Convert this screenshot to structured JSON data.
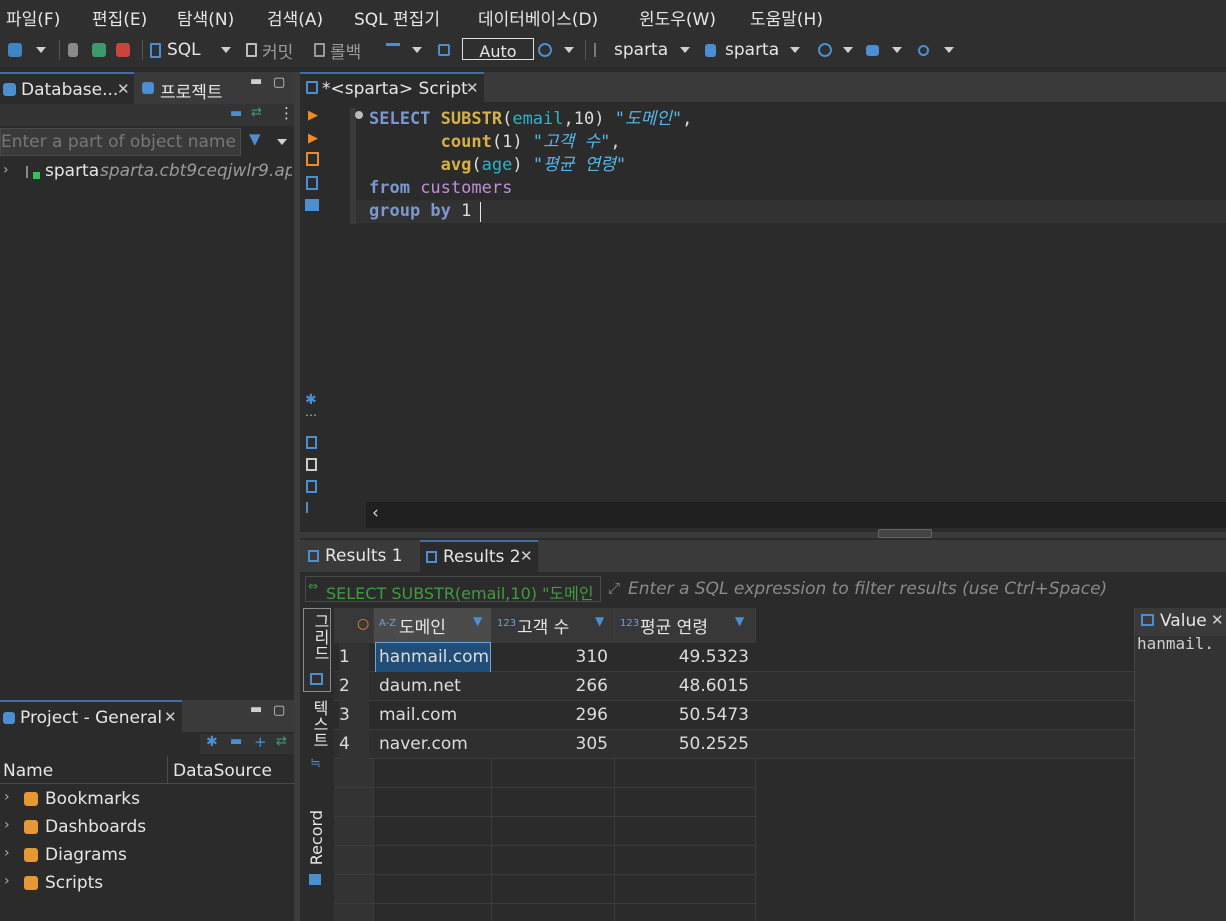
{
  "menu": [
    "파일(F)",
    "편집(E)",
    "탐색(N)",
    "검색(A)",
    "SQL 편집기",
    "데이터베이스(D)",
    "윈도우(W)",
    "도움말(H)"
  ],
  "toolbar": {
    "sql_label": "SQL",
    "commit_label": "커밋",
    "rollback_label": "롤백",
    "transaction_mode": "Auto",
    "datasource": "sparta",
    "schema": "sparta"
  },
  "db_navigator": {
    "tab_label": "Database...",
    "projects_tab_label": "프로젝트",
    "filter_placeholder": "Enter a part of object name h",
    "tree": [
      {
        "name": "sparta",
        "host": "sparta.cbt9ceqjwlr9.ap..."
      }
    ]
  },
  "project_panel": {
    "tab_label": "Project - General",
    "columns": [
      "Name",
      "DataSource"
    ],
    "items": [
      "Bookmarks",
      "Dashboards",
      "Diagrams",
      "Scripts"
    ]
  },
  "editor": {
    "tab_label": "*<sparta> Script",
    "lines": [
      {
        "parts": [
          {
            "t": "SELECT ",
            "c": "kw"
          },
          {
            "t": "SUBSTR",
            "c": "fn"
          },
          {
            "t": "(",
            "c": "plain"
          },
          {
            "t": "email",
            "c": "col"
          },
          {
            "t": ",10) ",
            "c": "plain"
          },
          {
            "t": "\"도메인\"",
            "c": "str"
          },
          {
            "t": ",",
            "c": "plain"
          }
        ]
      },
      {
        "parts": [
          {
            "t": "       ",
            "c": "plain"
          },
          {
            "t": "count",
            "c": "fn"
          },
          {
            "t": "(1) ",
            "c": "plain"
          },
          {
            "t": "\"고객 수\"",
            "c": "str"
          },
          {
            "t": ",",
            "c": "plain"
          }
        ]
      },
      {
        "parts": [
          {
            "t": "       ",
            "c": "plain"
          },
          {
            "t": "avg",
            "c": "fn"
          },
          {
            "t": "(",
            "c": "plain"
          },
          {
            "t": "age",
            "c": "col"
          },
          {
            "t": ") ",
            "c": "plain"
          },
          {
            "t": "\"평균 연령\"",
            "c": "str"
          }
        ]
      },
      {
        "parts": [
          {
            "t": "from ",
            "c": "kw"
          },
          {
            "t": "customers",
            "c": "tbl"
          }
        ]
      },
      {
        "parts": [
          {
            "t": "group by ",
            "c": "kw"
          },
          {
            "t": "1",
            "c": "num"
          }
        ]
      }
    ]
  },
  "results": {
    "tabs": [
      "Results 1",
      "Results 2"
    ],
    "active_tab": "Results 2",
    "query_preview": "SELECT SUBSTR(email,10) \"도메인",
    "filter_placeholder": "Enter a SQL expression to filter results (use Ctrl+Space)",
    "side_tabs": [
      "그리드",
      "텍스트",
      "Record"
    ],
    "columns": [
      {
        "type": "A-Z",
        "name": "도메인"
      },
      {
        "type": "123",
        "name": "고객 수"
      },
      {
        "type": "123",
        "name": "평균 연령"
      }
    ],
    "rows": [
      {
        "n": "1",
        "domain": "hanmail.com",
        "count": "310",
        "avg": "49.5323"
      },
      {
        "n": "2",
        "domain": "daum.net",
        "count": "266",
        "avg": "48.6015"
      },
      {
        "n": "3",
        "domain": "mail.com",
        "count": "296",
        "avg": "50.5473"
      },
      {
        "n": "4",
        "domain": "naver.com",
        "count": "305",
        "avg": "50.2525"
      }
    ],
    "value_panel": {
      "tab_label": "Value",
      "content": "hanmail."
    }
  }
}
